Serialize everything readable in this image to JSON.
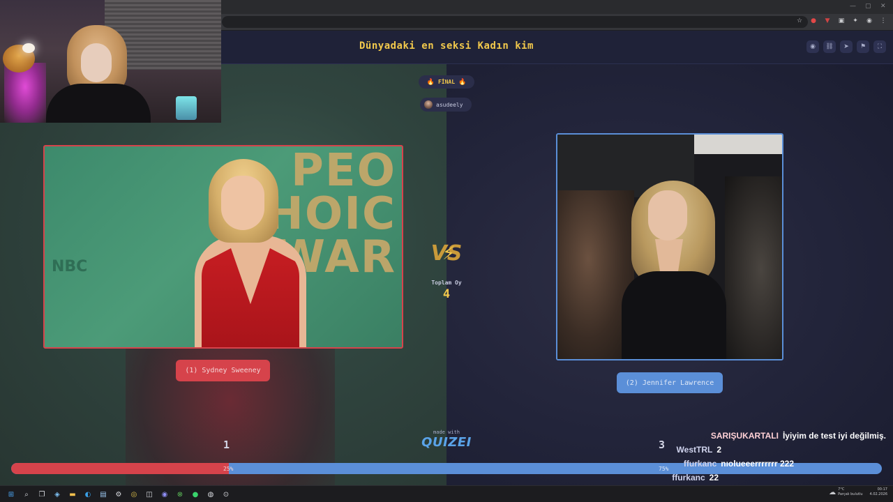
{
  "browser": {
    "window_controls": [
      "—",
      "▢",
      "✕"
    ],
    "toolbar_icons": [
      "star-icon",
      "extension-red-icon",
      "extension-shield-icon",
      "extension-puzzle-icon",
      "profile-icon",
      "menu-icon"
    ]
  },
  "quiz": {
    "title": "Dünyadaki en seksi Kadın kim",
    "round_label": "FİNAL",
    "creator": "asudeely",
    "total_votes_label": "Toplam Oy",
    "total_votes": "4",
    "made_with": "made with",
    "brand": "QUIZEI",
    "header_actions": [
      "eye-icon",
      "link-icon",
      "send-icon",
      "flag-icon",
      "fullscreen-icon"
    ]
  },
  "options": [
    {
      "label": "(1) Sydney Sweeney",
      "votes": "1",
      "percent_label": "25%",
      "percent": 25,
      "color": "#d6434b"
    },
    {
      "label": "(2) Jennifer Lawrence",
      "votes": "3",
      "percent_label": "75%",
      "percent": 75,
      "color": "#5b8fd8"
    }
  ],
  "chat": [
    {
      "user": "SARIŞUKARTALI",
      "message": "İyiyim de test iyi değilmiş.",
      "highlight": true
    },
    {
      "user": "WestTRL",
      "message": "2",
      "highlight": false
    },
    {
      "user": "ffurkanc",
      "message": "nıolueeerrrrrrr 222",
      "highlight": false
    },
    {
      "user": "ffurkanc",
      "message": "22",
      "highlight": false
    }
  ],
  "taskbar": {
    "apps": [
      "windows-start-icon",
      "search-icon",
      "task-view-icon",
      "widgets-icon",
      "file-explorer-icon",
      "edge-icon",
      "store-icon",
      "settings-icon",
      "chrome-icon",
      "camera-icon",
      "discord-icon",
      "xbox-icon",
      "spotify-icon",
      "steam-icon",
      "obs-icon"
    ],
    "weather_temp": "7°C",
    "weather_desc": "Parçalı bulutlu",
    "time": "00:17",
    "date": "4.02.2026"
  }
}
